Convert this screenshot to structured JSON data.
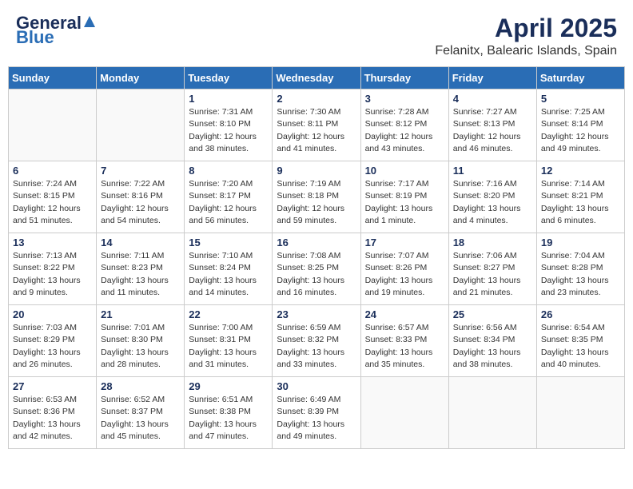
{
  "header": {
    "logo_general": "General",
    "logo_blue": "Blue",
    "month_title": "April 2025",
    "location": "Felanitx, Balearic Islands, Spain"
  },
  "weekdays": [
    "Sunday",
    "Monday",
    "Tuesday",
    "Wednesday",
    "Thursday",
    "Friday",
    "Saturday"
  ],
  "weeks": [
    [
      {
        "day": "",
        "detail": ""
      },
      {
        "day": "",
        "detail": ""
      },
      {
        "day": "1",
        "detail": "Sunrise: 7:31 AM\nSunset: 8:10 PM\nDaylight: 12 hours\nand 38 minutes."
      },
      {
        "day": "2",
        "detail": "Sunrise: 7:30 AM\nSunset: 8:11 PM\nDaylight: 12 hours\nand 41 minutes."
      },
      {
        "day": "3",
        "detail": "Sunrise: 7:28 AM\nSunset: 8:12 PM\nDaylight: 12 hours\nand 43 minutes."
      },
      {
        "day": "4",
        "detail": "Sunrise: 7:27 AM\nSunset: 8:13 PM\nDaylight: 12 hours\nand 46 minutes."
      },
      {
        "day": "5",
        "detail": "Sunrise: 7:25 AM\nSunset: 8:14 PM\nDaylight: 12 hours\nand 49 minutes."
      }
    ],
    [
      {
        "day": "6",
        "detail": "Sunrise: 7:24 AM\nSunset: 8:15 PM\nDaylight: 12 hours\nand 51 minutes."
      },
      {
        "day": "7",
        "detail": "Sunrise: 7:22 AM\nSunset: 8:16 PM\nDaylight: 12 hours\nand 54 minutes."
      },
      {
        "day": "8",
        "detail": "Sunrise: 7:20 AM\nSunset: 8:17 PM\nDaylight: 12 hours\nand 56 minutes."
      },
      {
        "day": "9",
        "detail": "Sunrise: 7:19 AM\nSunset: 8:18 PM\nDaylight: 12 hours\nand 59 minutes."
      },
      {
        "day": "10",
        "detail": "Sunrise: 7:17 AM\nSunset: 8:19 PM\nDaylight: 13 hours\nand 1 minute."
      },
      {
        "day": "11",
        "detail": "Sunrise: 7:16 AM\nSunset: 8:20 PM\nDaylight: 13 hours\nand 4 minutes."
      },
      {
        "day": "12",
        "detail": "Sunrise: 7:14 AM\nSunset: 8:21 PM\nDaylight: 13 hours\nand 6 minutes."
      }
    ],
    [
      {
        "day": "13",
        "detail": "Sunrise: 7:13 AM\nSunset: 8:22 PM\nDaylight: 13 hours\nand 9 minutes."
      },
      {
        "day": "14",
        "detail": "Sunrise: 7:11 AM\nSunset: 8:23 PM\nDaylight: 13 hours\nand 11 minutes."
      },
      {
        "day": "15",
        "detail": "Sunrise: 7:10 AM\nSunset: 8:24 PM\nDaylight: 13 hours\nand 14 minutes."
      },
      {
        "day": "16",
        "detail": "Sunrise: 7:08 AM\nSunset: 8:25 PM\nDaylight: 13 hours\nand 16 minutes."
      },
      {
        "day": "17",
        "detail": "Sunrise: 7:07 AM\nSunset: 8:26 PM\nDaylight: 13 hours\nand 19 minutes."
      },
      {
        "day": "18",
        "detail": "Sunrise: 7:06 AM\nSunset: 8:27 PM\nDaylight: 13 hours\nand 21 minutes."
      },
      {
        "day": "19",
        "detail": "Sunrise: 7:04 AM\nSunset: 8:28 PM\nDaylight: 13 hours\nand 23 minutes."
      }
    ],
    [
      {
        "day": "20",
        "detail": "Sunrise: 7:03 AM\nSunset: 8:29 PM\nDaylight: 13 hours\nand 26 minutes."
      },
      {
        "day": "21",
        "detail": "Sunrise: 7:01 AM\nSunset: 8:30 PM\nDaylight: 13 hours\nand 28 minutes."
      },
      {
        "day": "22",
        "detail": "Sunrise: 7:00 AM\nSunset: 8:31 PM\nDaylight: 13 hours\nand 31 minutes."
      },
      {
        "day": "23",
        "detail": "Sunrise: 6:59 AM\nSunset: 8:32 PM\nDaylight: 13 hours\nand 33 minutes."
      },
      {
        "day": "24",
        "detail": "Sunrise: 6:57 AM\nSunset: 8:33 PM\nDaylight: 13 hours\nand 35 minutes."
      },
      {
        "day": "25",
        "detail": "Sunrise: 6:56 AM\nSunset: 8:34 PM\nDaylight: 13 hours\nand 38 minutes."
      },
      {
        "day": "26",
        "detail": "Sunrise: 6:54 AM\nSunset: 8:35 PM\nDaylight: 13 hours\nand 40 minutes."
      }
    ],
    [
      {
        "day": "27",
        "detail": "Sunrise: 6:53 AM\nSunset: 8:36 PM\nDaylight: 13 hours\nand 42 minutes."
      },
      {
        "day": "28",
        "detail": "Sunrise: 6:52 AM\nSunset: 8:37 PM\nDaylight: 13 hours\nand 45 minutes."
      },
      {
        "day": "29",
        "detail": "Sunrise: 6:51 AM\nSunset: 8:38 PM\nDaylight: 13 hours\nand 47 minutes."
      },
      {
        "day": "30",
        "detail": "Sunrise: 6:49 AM\nSunset: 8:39 PM\nDaylight: 13 hours\nand 49 minutes."
      },
      {
        "day": "",
        "detail": ""
      },
      {
        "day": "",
        "detail": ""
      },
      {
        "day": "",
        "detail": ""
      }
    ]
  ]
}
